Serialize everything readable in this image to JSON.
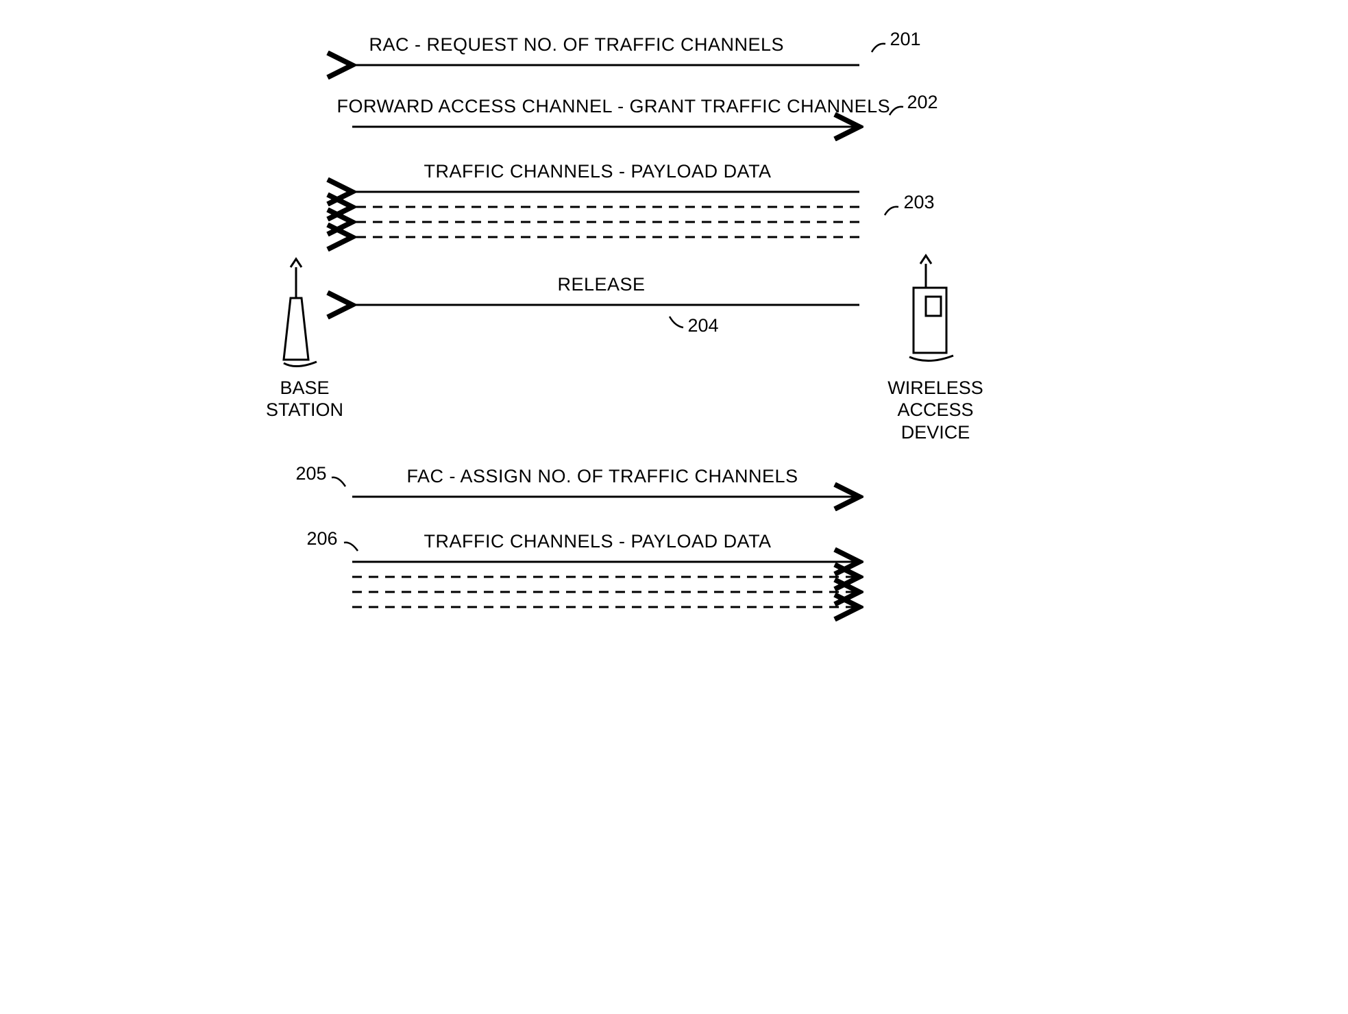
{
  "messages": {
    "m1": {
      "label": "RAC - REQUEST NO. OF TRAFFIC CHANNELS",
      "ref": "201"
    },
    "m2": {
      "label": "FORWARD ACCESS CHANNEL - GRANT TRAFFIC CHANNELS",
      "ref": "202"
    },
    "m3": {
      "label": "TRAFFIC CHANNELS - PAYLOAD DATA",
      "ref": "203"
    },
    "m4": {
      "label": "RELEASE",
      "ref": "204"
    },
    "m5": {
      "label": "FAC - ASSIGN NO. OF TRAFFIC CHANNELS",
      "ref": "205"
    },
    "m6": {
      "label": "TRAFFIC CHANNELS - PAYLOAD DATA",
      "ref": "206"
    }
  },
  "endpoints": {
    "left": "BASE\nSTATION",
    "right": "WIRELESS\nACCESS\nDEVICE"
  }
}
